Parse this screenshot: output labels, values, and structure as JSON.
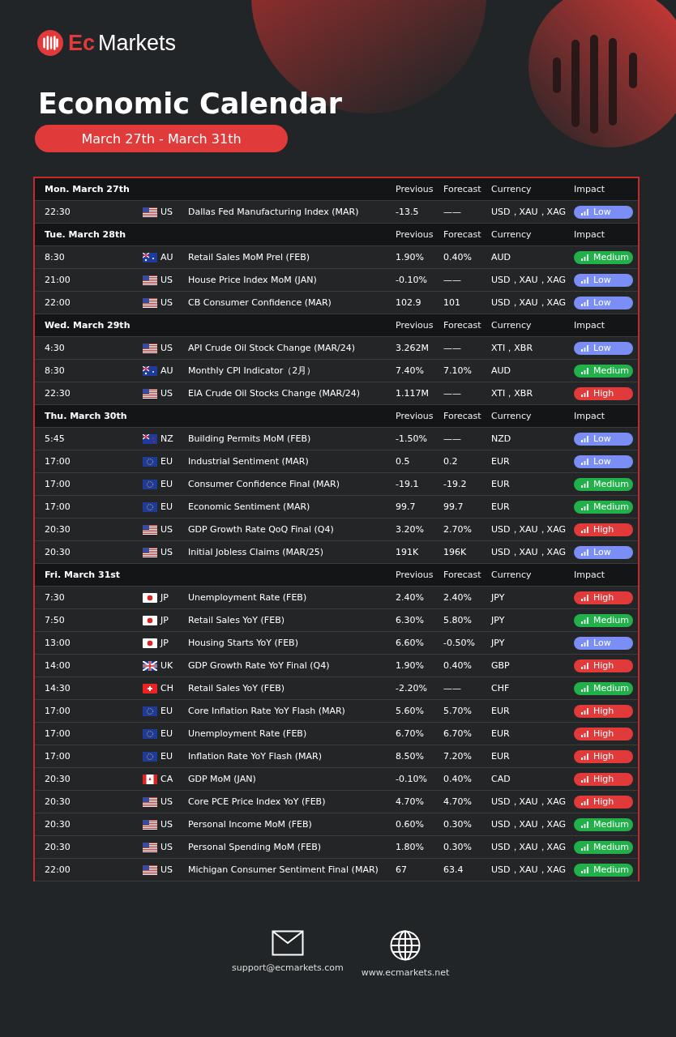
{
  "brand": {
    "accent": "Ec",
    "name": "Markets"
  },
  "title": "Economic Calendar",
  "date_range": "March 27th - March 31th",
  "days": [
    {
      "label": "Mon. March 27th",
      "columns": [
        "Previous",
        "Forecast",
        "Currency",
        "Impact"
      ],
      "events": [
        {
          "time": "22:30",
          "flag": {
            "kind": "us"
          },
          "country": "US",
          "event": "Dallas Fed Manufacturing Index (MAR)",
          "previous": "-13.5",
          "forecast": "——",
          "currency": "USD，XAU，XAG",
          "impact": {
            "kind": "low",
            "label": "Low"
          }
        }
      ]
    },
    {
      "label": "Tue. March 28th",
      "columns": [
        "Previous",
        "Forecast",
        "Currency",
        "Impact"
      ],
      "events": [
        {
          "time": "8:30",
          "flag": {
            "kind": "au"
          },
          "country": "AU",
          "event": "Retail Sales MoM Prel (FEB)",
          "previous": "1.90%",
          "forecast": "0.40%",
          "currency": "AUD",
          "impact": {
            "kind": "medium",
            "label": "Medium"
          }
        },
        {
          "time": "21:00",
          "flag": {
            "kind": "us"
          },
          "country": "US",
          "event": "House Price Index MoM (JAN)",
          "previous": "-0.10%",
          "forecast": "——",
          "currency": "USD，XAU，XAG",
          "impact": {
            "kind": "low",
            "label": "Low"
          }
        },
        {
          "time": "22:00",
          "flag": {
            "kind": "us"
          },
          "country": "US",
          "event": "CB Consumer Confidence (MAR)",
          "previous": "102.9",
          "forecast": "101",
          "currency": "USD，XAU，XAG",
          "impact": {
            "kind": "low",
            "label": "Low"
          }
        }
      ]
    },
    {
      "label": "Wed. March 29th",
      "columns": [
        "Previous",
        "Forecast",
        "Currency",
        "Impact"
      ],
      "events": [
        {
          "time": "4:30",
          "flag": {
            "kind": "us"
          },
          "country": "US",
          "event": "API Crude Oil Stock Change (MAR/24)",
          "previous": "3.262M",
          "forecast": "——",
          "currency": "XTI，XBR",
          "impact": {
            "kind": "low",
            "label": "Low"
          }
        },
        {
          "time": "8:30",
          "flag": {
            "kind": "au"
          },
          "country": "AU",
          "event": "Monthly CPI Indicator（2月）",
          "previous": "7.40%",
          "forecast": "7.10%",
          "currency": "AUD",
          "impact": {
            "kind": "medium",
            "label": "Medium"
          }
        },
        {
          "time": "22:30",
          "flag": {
            "kind": "us"
          },
          "country": "US",
          "event": "EIA Crude Oil Stocks Change (MAR/24)",
          "previous": "1.117M",
          "forecast": "——",
          "currency": "XTI，XBR",
          "impact": {
            "kind": "high",
            "label": "High"
          }
        }
      ]
    },
    {
      "label": "Thu. March 30th",
      "columns": [
        "Previous",
        "Forecast",
        "Currency",
        "Impact"
      ],
      "events": [
        {
          "time": "5:45",
          "flag": {
            "kind": "nz"
          },
          "country": "NZ",
          "event": "Building Permits MoM (FEB)",
          "previous": "-1.50%",
          "forecast": "——",
          "currency": "NZD",
          "impact": {
            "kind": "low",
            "label": "Low"
          }
        },
        {
          "time": "17:00",
          "flag": {
            "kind": "eu"
          },
          "country": "EU",
          "event": "Industrial Sentiment (MAR)",
          "previous": "0.5",
          "forecast": "0.2",
          "currency": "EUR",
          "impact": {
            "kind": "low",
            "label": "Low"
          }
        },
        {
          "time": "17:00",
          "flag": {
            "kind": "eu"
          },
          "country": "EU",
          "event": "Consumer Confidence Final (MAR)",
          "previous": "-19.1",
          "forecast": "-19.2",
          "currency": "EUR",
          "impact": {
            "kind": "medium",
            "label": "Medium"
          }
        },
        {
          "time": "17:00",
          "flag": {
            "kind": "eu"
          },
          "country": "EU",
          "event": "Economic Sentiment (MAR)",
          "previous": "99.7",
          "forecast": "99.7",
          "currency": "EUR",
          "impact": {
            "kind": "medium",
            "label": "Medium"
          }
        },
        {
          "time": "20:30",
          "flag": {
            "kind": "us"
          },
          "country": "US",
          "event": "GDP Growth Rate QoQ Final (Q4)",
          "previous": "3.20%",
          "forecast": "2.70%",
          "currency": "USD，XAU，XAG",
          "impact": {
            "kind": "high",
            "label": "High"
          }
        },
        {
          "time": "20:30",
          "flag": {
            "kind": "us"
          },
          "country": "US",
          "event": "Initial Jobless Claims (MAR/25)",
          "previous": "191K",
          "forecast": "196K",
          "currency": "USD，XAU，XAG",
          "impact": {
            "kind": "low",
            "label": "Low"
          }
        }
      ]
    },
    {
      "label": "Fri. March 31st",
      "columns": [
        "Previous",
        "Forecast",
        "Currency",
        "Impact"
      ],
      "events": [
        {
          "time": "7:30",
          "flag": {
            "kind": "jp"
          },
          "country": "JP",
          "event": "Unemployment Rate (FEB)",
          "previous": "2.40%",
          "forecast": "2.40%",
          "currency": "JPY",
          "impact": {
            "kind": "high",
            "label": "High"
          }
        },
        {
          "time": "7:50",
          "flag": {
            "kind": "jp"
          },
          "country": "JP",
          "event": "Retail Sales YoY (FEB)",
          "previous": "6.30%",
          "forecast": "5.80%",
          "currency": "JPY",
          "impact": {
            "kind": "medium",
            "label": "Medium"
          }
        },
        {
          "time": "13:00",
          "flag": {
            "kind": "jp"
          },
          "country": "JP",
          "event": "Housing Starts YoY (FEB)",
          "previous": "6.60%",
          "forecast": "-0.50%",
          "currency": "JPY",
          "impact": {
            "kind": "low",
            "label": "Low"
          }
        },
        {
          "time": "14:00",
          "flag": {
            "kind": "uk"
          },
          "country": "UK",
          "event": "GDP Growth Rate YoY Final (Q4)",
          "previous": "1.90%",
          "forecast": "0.40%",
          "currency": "GBP",
          "impact": {
            "kind": "high",
            "label": "High"
          }
        },
        {
          "time": "14:30",
          "flag": {
            "kind": "ch"
          },
          "country": "CH",
          "event": "Retail Sales YoY (FEB)",
          "previous": "-2.20%",
          "forecast": "——",
          "currency": "CHF",
          "impact": {
            "kind": "medium",
            "label": "Medium"
          }
        },
        {
          "time": "17:00",
          "flag": {
            "kind": "eu"
          },
          "country": "EU",
          "event": "Core Inflation Rate YoY Flash (MAR)",
          "previous": "5.60%",
          "forecast": "5.70%",
          "currency": "EUR",
          "impact": {
            "kind": "high",
            "label": "High"
          }
        },
        {
          "time": "17:00",
          "flag": {
            "kind": "eu"
          },
          "country": "EU",
          "event": "Unemployment Rate (FEB)",
          "previous": "6.70%",
          "forecast": "6.70%",
          "currency": "EUR",
          "impact": {
            "kind": "high",
            "label": "High"
          }
        },
        {
          "time": "17:00",
          "flag": {
            "kind": "eu"
          },
          "country": "EU",
          "event": "Inflation Rate YoY Flash (MAR)",
          "previous": "8.50%",
          "forecast": "7.20%",
          "currency": "EUR",
          "impact": {
            "kind": "high",
            "label": "High"
          }
        },
        {
          "time": "20:30",
          "flag": {
            "kind": "ca"
          },
          "country": "CA",
          "event": "GDP MoM (JAN)",
          "previous": "-0.10%",
          "forecast": "0.40%",
          "currency": "CAD",
          "impact": {
            "kind": "high",
            "label": "High"
          }
        },
        {
          "time": "20:30",
          "flag": {
            "kind": "us"
          },
          "country": "US",
          "event": "Core PCE Price Index YoY (FEB)",
          "previous": "4.70%",
          "forecast": "4.70%",
          "currency": "USD，XAU，XAG",
          "impact": {
            "kind": "high",
            "label": "High"
          }
        },
        {
          "time": "20:30",
          "flag": {
            "kind": "us"
          },
          "country": "US",
          "event": "Personal Income MoM (FEB)",
          "previous": "0.60%",
          "forecast": "0.30%",
          "currency": "USD，XAU，XAG",
          "impact": {
            "kind": "medium",
            "label": "Medium"
          }
        },
        {
          "time": "20:30",
          "flag": {
            "kind": "us"
          },
          "country": "US",
          "event": "Personal Spending MoM (FEB)",
          "previous": "1.80%",
          "forecast": "0.30%",
          "currency": "USD，XAU，XAG",
          "impact": {
            "kind": "medium",
            "label": "Medium"
          }
        },
        {
          "time": "22:00",
          "flag": {
            "kind": "us"
          },
          "country": "US",
          "event": "Michigan Consumer Sentiment Final (MAR)",
          "previous": "67",
          "forecast": "63.4",
          "currency": "USD，XAU，XAG",
          "impact": {
            "kind": "medium",
            "label": "Medium"
          }
        }
      ]
    }
  ],
  "footer": {
    "email": "support@ecmarkets.com",
    "website": "www.ecmarkets.net"
  }
}
